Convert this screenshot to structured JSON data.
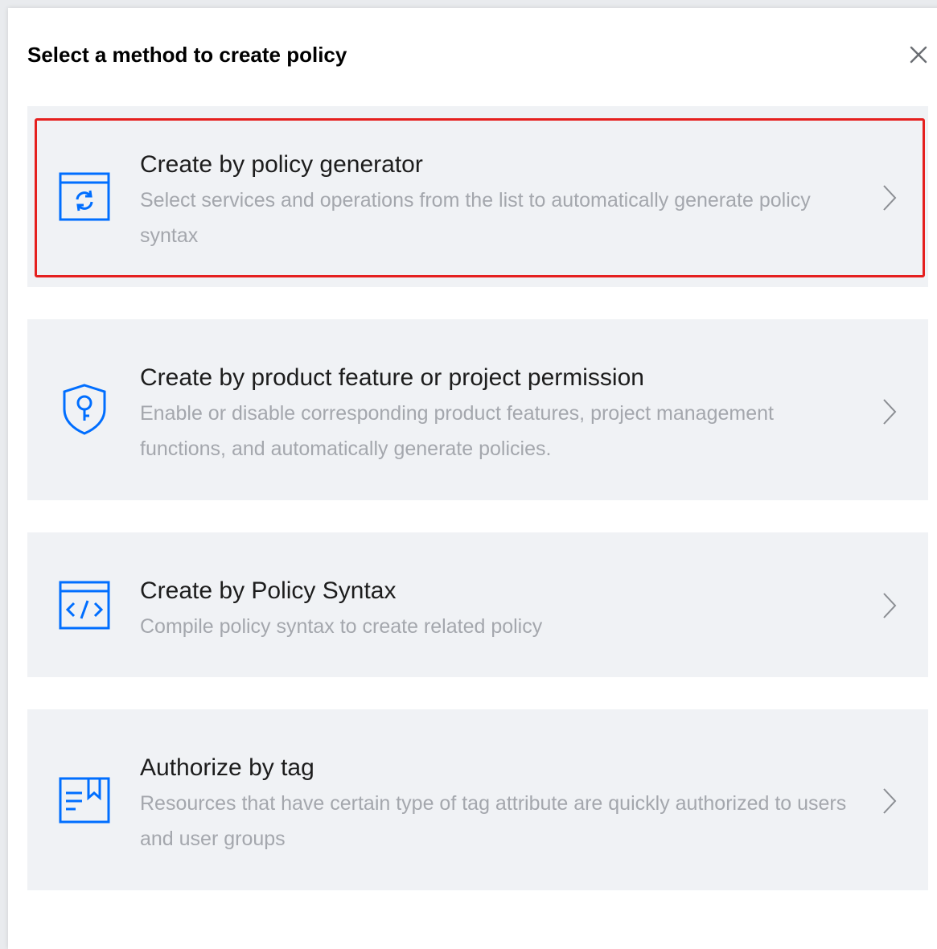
{
  "dialog": {
    "title": "Select a method to create policy",
    "close_icon": "close-icon"
  },
  "options": [
    {
      "title": "Create by policy generator",
      "description": "Select services and operations from the list to automatically generate policy syntax",
      "icon": "refresh-window-icon",
      "highlighted": true
    },
    {
      "title": "Create by product feature or project permission",
      "description": "Enable or disable corresponding product features, project management functions, and automatically generate policies.",
      "icon": "shield-key-icon",
      "highlighted": false
    },
    {
      "title": "Create by Policy Syntax",
      "description": "Compile policy syntax to create related policy",
      "icon": "code-window-icon",
      "highlighted": false
    },
    {
      "title": "Authorize by tag",
      "description": "Resources that have certain type of tag attribute are quickly authorized to users and user groups",
      "icon": "tag-book-icon",
      "highlighted": false
    }
  ],
  "colors": {
    "accent": "#006eff",
    "highlight_border": "#e5201f",
    "card_background": "#f0f2f5",
    "description_text": "#a4a7ad"
  }
}
